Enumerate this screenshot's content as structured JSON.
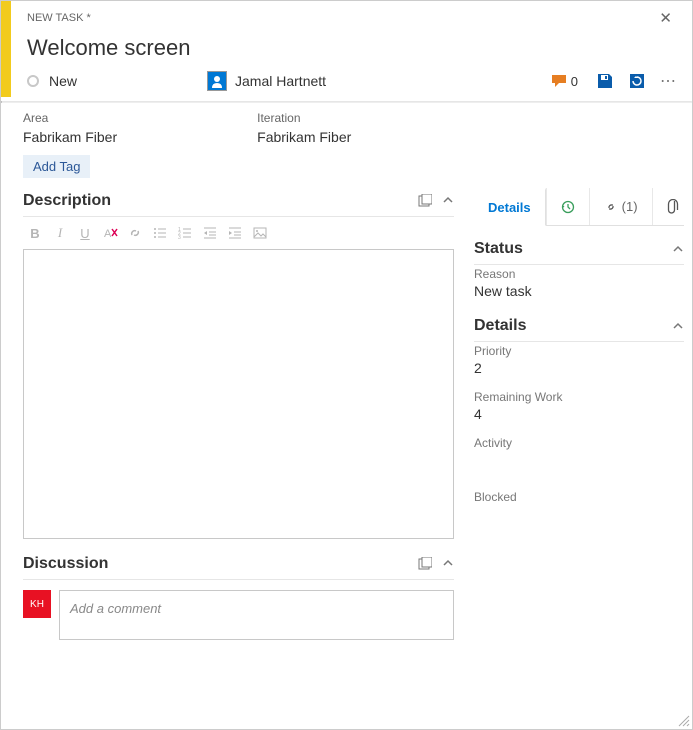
{
  "header": {
    "type_label": "NEW TASK *",
    "title": "Welcome screen"
  },
  "info": {
    "state": "New",
    "assignee": "Jamal Hartnett",
    "comment_count": "0"
  },
  "fields": {
    "area_label": "Area",
    "area_value": "Fabrikam Fiber",
    "iteration_label": "Iteration",
    "iteration_value": "Fabrikam Fiber"
  },
  "tags": {
    "add_label": "Add Tag"
  },
  "tabs": {
    "details": "Details",
    "links": "(1)"
  },
  "sections": {
    "description": "Description",
    "discussion": "Discussion",
    "status": "Status",
    "details": "Details"
  },
  "side": {
    "reason_label": "Reason",
    "reason_value": "New task",
    "priority_label": "Priority",
    "priority_value": "2",
    "remaining_label": "Remaining Work",
    "remaining_value": "4",
    "activity_label": "Activity",
    "blocked_label": "Blocked"
  },
  "discussion": {
    "avatar_initials": "KH",
    "placeholder": "Add a comment"
  }
}
